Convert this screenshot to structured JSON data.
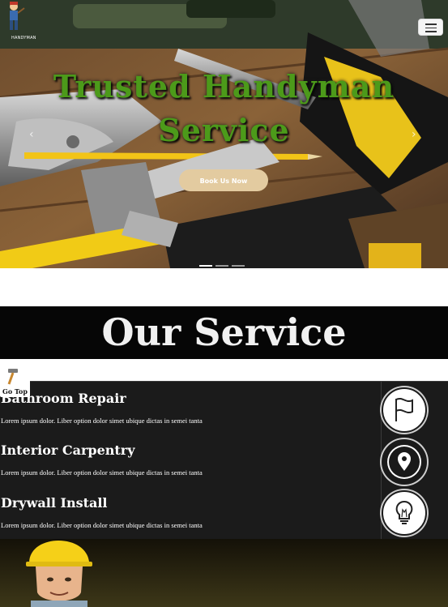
{
  "header": {
    "logo_text": "HANDYMAN",
    "menu_icon": "hamburger-menu-icon"
  },
  "hero": {
    "title_line1": "Trusted Handyman",
    "title_line2": "Service",
    "button_label": "Book Us Now",
    "prev_arrow": "‹",
    "next_arrow": "›",
    "slides": 3,
    "active_slide": 1
  },
  "services_section": {
    "title": "Our Service",
    "items": [
      {
        "title": "Bathroom Repair",
        "description": "Lorem ipsum dolor. Liber option dolor simet ubique dictas in semei tanta",
        "icon": "flag-icon"
      },
      {
        "title": "Interior Carpentry",
        "description": "Lorem ipsum dolor. Liber option dolor simet ubique dictas in semei tanta",
        "icon": "location-pin-icon"
      },
      {
        "title": "Drywall Install",
        "description": "Lorem ipsum dolor. Liber option dolor simet ubique dictas in semei tanta",
        "icon": "lightbulb-icon"
      }
    ]
  },
  "go_top": {
    "label": "Go Top",
    "icon": "hammer-icon"
  },
  "colors": {
    "hero_title": "#4c9a1a",
    "button_bg": "#e3cba0",
    "band_bg": "#060606",
    "list_bg": "#1b1b1b"
  }
}
